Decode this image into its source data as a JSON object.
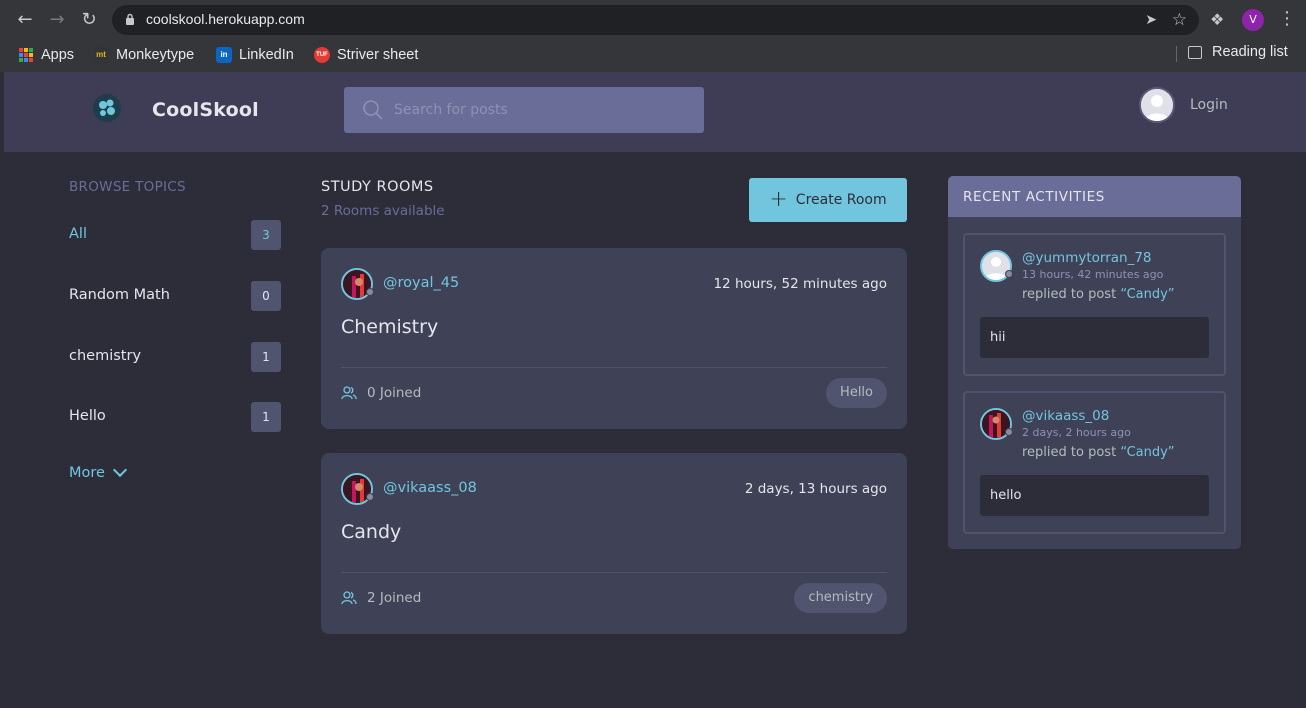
{
  "browser": {
    "url": "coolskool.herokuapp.com",
    "profile_initial": "V",
    "bookmarks": [
      {
        "label": "Apps",
        "icon": "apps-grid-icon"
      },
      {
        "label": "Monkeytype",
        "icon": "monkeytype-icon"
      },
      {
        "label": "LinkedIn",
        "icon": "linkedin-icon"
      },
      {
        "label": "Striver sheet",
        "icon": "tuf-icon"
      }
    ],
    "reading_list": "Reading list"
  },
  "header": {
    "brand": "CoolSkool",
    "search_placeholder": "Search for posts",
    "login_label": "Login"
  },
  "sidebar": {
    "title": "BROWSE TOPICS",
    "topics": [
      {
        "name": "All",
        "count": "3"
      },
      {
        "name": "Random Math",
        "count": "0"
      },
      {
        "name": "chemistry",
        "count": "1"
      },
      {
        "name": "Hello",
        "count": "1"
      }
    ],
    "more_label": "More"
  },
  "rooms": {
    "title": "STUDY ROOMS",
    "subtitle": "2 Rooms available",
    "create_label": "Create Room",
    "items": [
      {
        "host": "@royal_45",
        "time": "12 hours, 52 minutes ago",
        "title": "Chemistry",
        "joined": "0 Joined",
        "topic": "Hello"
      },
      {
        "host": "@vikaass_08",
        "time": "2 days, 13 hours ago",
        "title": "Candy",
        "joined": "2 Joined",
        "topic": "chemistry"
      }
    ]
  },
  "activities": {
    "title": "RECENT ACTIVITIES",
    "items": [
      {
        "user": "@yummytorran_78",
        "ago": "13 hours, 42 minutes ago",
        "action": "replied to post ",
        "post": "“Candy”",
        "reply": "hii"
      },
      {
        "user": "@vikaass_08",
        "ago": "2 days, 2 hours ago",
        "action": "replied to post ",
        "post": "“Candy”",
        "reply": "hello"
      }
    ]
  },
  "colors": {
    "accent": "#71c6dd",
    "header_bg": "#3f3d56",
    "card_bg": "#3f4156",
    "page_bg": "#2d2d39",
    "muted": "#696d97"
  }
}
